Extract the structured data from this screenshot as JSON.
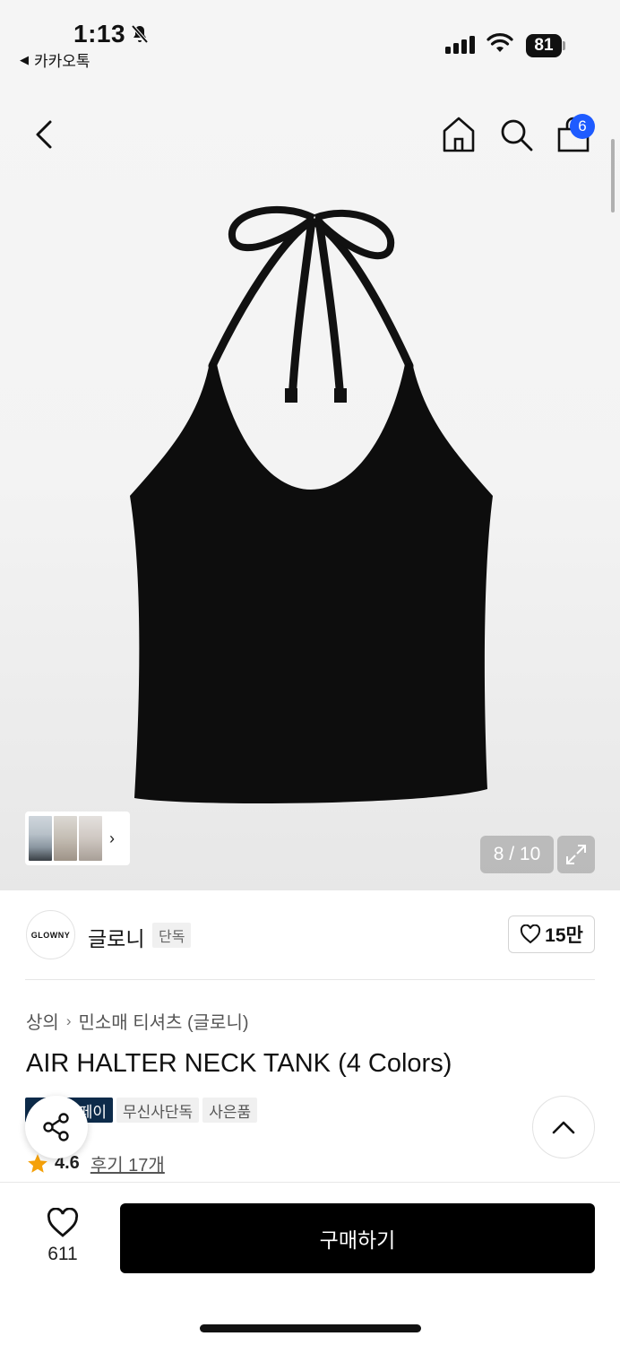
{
  "status_bar": {
    "time": "1:13",
    "back_app": "카카오톡",
    "battery": "81"
  },
  "header": {
    "cart_count": "6",
    "icons": [
      "back-icon",
      "home-icon",
      "search-icon",
      "cart-icon"
    ]
  },
  "gallery": {
    "pager": "8 / 10",
    "thumbnails": 3
  },
  "brand": {
    "logo_text": "GLOWNY",
    "name": "글로니",
    "tag": "단독",
    "likes": "15만"
  },
  "product": {
    "breadcrumb": [
      "상의",
      "민소매 티셔츠 (글로니)"
    ],
    "title": "AIR HALTER NECK TANK (4 Colors)",
    "badges": [
      "페이",
      "무신사단독",
      "사은품"
    ],
    "rating": "4.6",
    "reviews": "후기 17개"
  },
  "bottom_bar": {
    "wish_count": "611",
    "buy_label": "구매하기"
  },
  "colors": {
    "accent_badge": "#1e5bff",
    "buy_button": "#000000",
    "star": "#f5a10a",
    "pay_badge": "#0d2b4a"
  }
}
